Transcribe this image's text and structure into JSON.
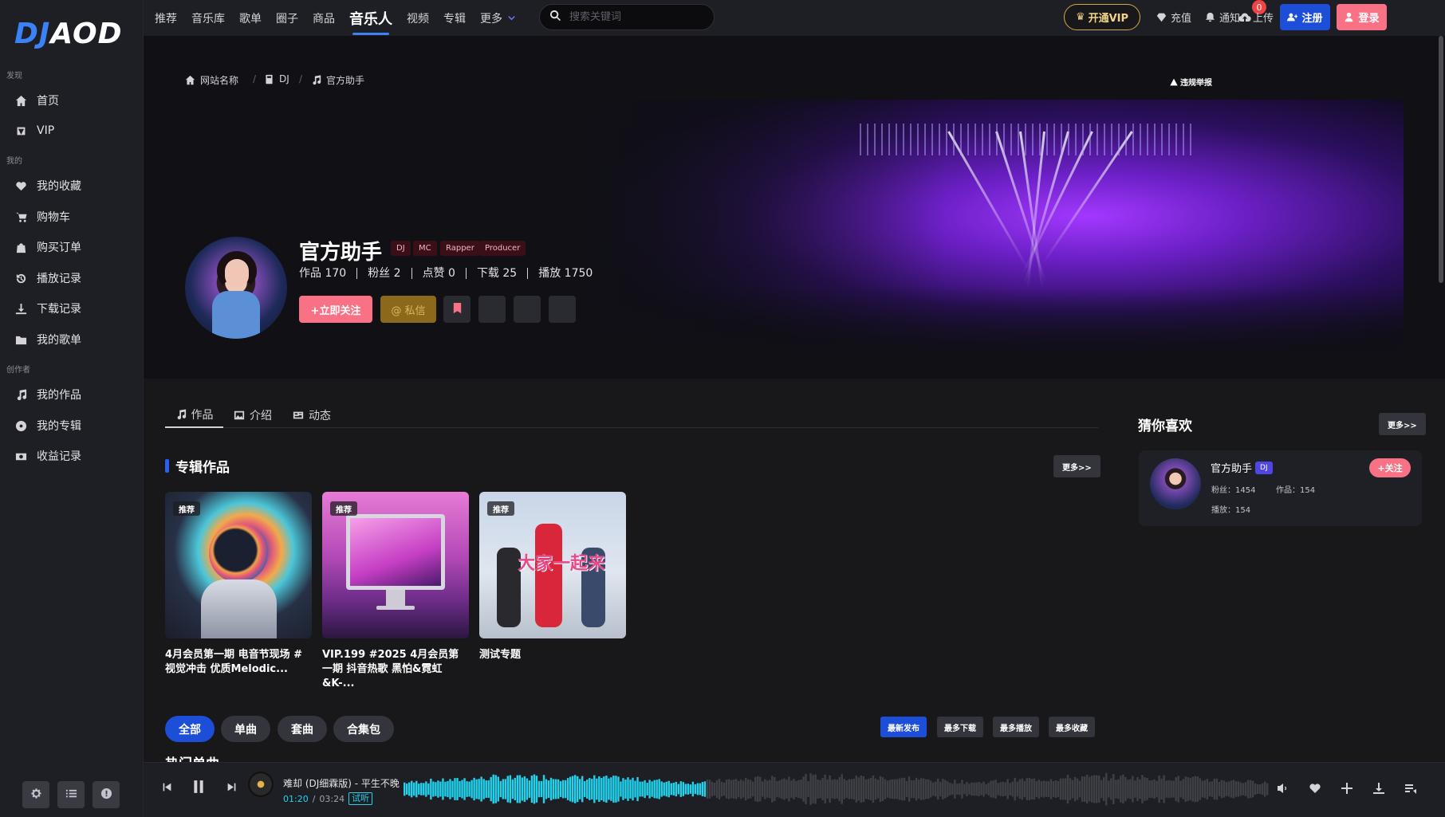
{
  "logo": {
    "part1": "DJ",
    "part2": "AOD"
  },
  "sidebar": {
    "sections": [
      {
        "title": "发现",
        "items": [
          {
            "label": "首页",
            "icon": "home-icon"
          },
          {
            "label": "VIP",
            "icon": "vip-icon"
          }
        ]
      },
      {
        "title": "我的",
        "items": [
          {
            "label": "我的收藏",
            "icon": "heart-icon"
          },
          {
            "label": "购物车",
            "icon": "cart-icon"
          },
          {
            "label": "购买订单",
            "icon": "bag-icon"
          },
          {
            "label": "播放记录",
            "icon": "history-icon"
          },
          {
            "label": "下载记录",
            "icon": "download-icon"
          },
          {
            "label": "我的歌单",
            "icon": "folder-icon"
          }
        ]
      },
      {
        "title": "创作者",
        "items": [
          {
            "label": "我的作品",
            "icon": "music-icon"
          },
          {
            "label": "我的专辑",
            "icon": "disc-icon"
          },
          {
            "label": "收益记录",
            "icon": "money-icon"
          }
        ]
      }
    ],
    "bottom_buttons": [
      "settings-icon",
      "list-icon",
      "info-icon"
    ]
  },
  "topnav": {
    "items": [
      "推荐",
      "音乐库",
      "歌单",
      "圈子",
      "商品",
      "音乐人",
      "视频",
      "专辑",
      "更多"
    ],
    "active": "音乐人",
    "search_placeholder": "搜索关键词",
    "vip": "开通VIP",
    "recharge": "充值",
    "notify": "通知",
    "notify_count": "0",
    "upload": "上传",
    "register": "注册",
    "login": "登录"
  },
  "breadcrumb": [
    "网站名称",
    "DJ",
    "官方助手"
  ],
  "report": "违规举报",
  "profile": {
    "name": "官方助手",
    "tags": [
      "DJ",
      "MC",
      "Rapper",
      "Producer"
    ],
    "stats": [
      {
        "label": "作品",
        "value": "170"
      },
      {
        "label": "粉丝",
        "value": "2"
      },
      {
        "label": "点赞",
        "value": "0"
      },
      {
        "label": "下载",
        "value": "25"
      },
      {
        "label": "播放",
        "value": "1750"
      }
    ],
    "follow": "+立即关注",
    "message": "@ 私信"
  },
  "tabs": [
    {
      "label": "作品",
      "icon": "music-icon"
    },
    {
      "label": "介绍",
      "icon": "image-icon"
    },
    {
      "label": "动态",
      "icon": "feed-icon"
    }
  ],
  "albums": {
    "title": "专辑作品",
    "more": "更多>>",
    "items": [
      {
        "badge": "推荐",
        "title": "4月会员第一期 电音节现场 # 视觉冲击 优质Melodic..."
      },
      {
        "badge": "推荐",
        "title": "VIP.199 #2025 4月会员第一期 抖音热歌 黑怕&霓虹&K-..."
      },
      {
        "badge": "推荐",
        "title": "测试专题",
        "cover_text": "大家一起来"
      }
    ]
  },
  "filters": {
    "types": [
      "全部",
      "单曲",
      "套曲",
      "合集包"
    ],
    "sorts": [
      "最新发布",
      "最多下载",
      "最多播放",
      "最多收藏"
    ]
  },
  "hot_title": "热门单曲",
  "guess": {
    "title": "猜你喜欢",
    "more": "更多>>",
    "card": {
      "name": "官方助手",
      "tag": "DJ",
      "fans": "粉丝：1454",
      "works": "作品：154",
      "plays": "播放：154",
      "follow": "+关注"
    }
  },
  "player": {
    "title": "难却 (DJ细霖版) - 平生不晚",
    "current": "01:20",
    "sep": "/",
    "total": "03:24",
    "trial": "试听",
    "progress": 0.35
  },
  "colors": {
    "accent": "#1d4ed8",
    "pink": "#f87185",
    "wave_played": "#22d3ee",
    "wave_rest": "#3f4046"
  }
}
